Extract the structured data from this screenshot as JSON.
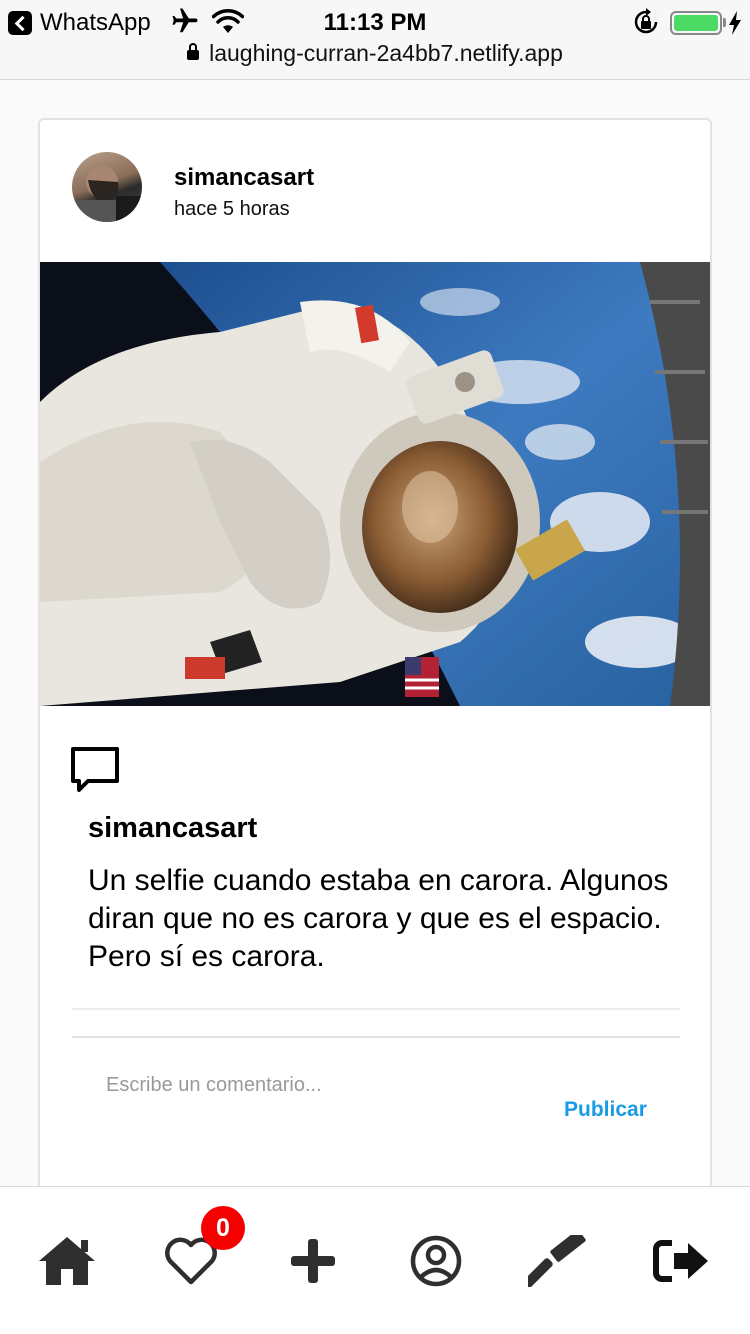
{
  "status_bar": {
    "back_app": "WhatsApp",
    "time": "11:13 PM",
    "url": "laughing-curran-2a4bb7.netlify.app",
    "battery_level": 1.0
  },
  "post": {
    "author": "simancasart",
    "time_ago": "hace 5 horas",
    "image_subject": "astronaut-spacewalk-photo",
    "caption_user": "simancasart",
    "caption": "Un selfie cuando estaba en carora. Algunos diran que no es carora y que es el espacio. Pero sí es carora.",
    "comment_placeholder": "Escribe un comentario...",
    "publish_label": "Publicar"
  },
  "nav": {
    "items": [
      {
        "icon": "home-icon"
      },
      {
        "icon": "heart-icon"
      },
      {
        "icon": "plus-icon"
      },
      {
        "icon": "user-circle-icon"
      },
      {
        "icon": "hammer-icon"
      },
      {
        "icon": "sign-out-icon"
      }
    ],
    "notifications_count": "0"
  },
  "colors": {
    "accent": "#1a9be6",
    "badge": "#f40000",
    "battery": "#4cd964"
  }
}
